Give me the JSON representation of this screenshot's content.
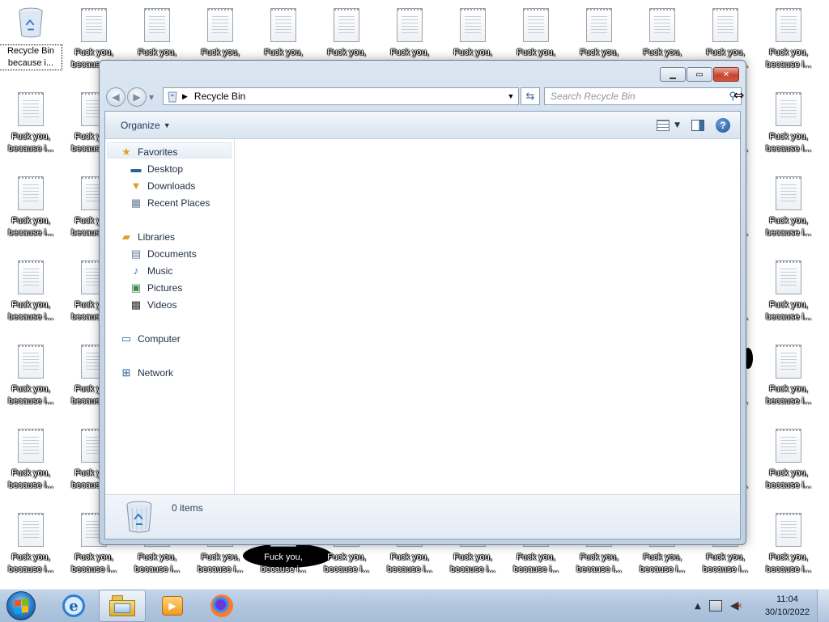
{
  "desktop": {
    "recycle_bin_label": "Recycle Bin",
    "recycle_bin_label2": "because i...",
    "file_label_line1": "Fuck you,",
    "file_label_line2": "because i..."
  },
  "window": {
    "title": "Recycle Bin",
    "address_path": "Recycle Bin",
    "search_placeholder": "Search Recycle Bin",
    "toolbar": {
      "organize_label": "Organize"
    },
    "nav_pane": {
      "favorites": {
        "label": "Favorites",
        "items": [
          {
            "label": "Desktop",
            "icon": "desktop-icon"
          },
          {
            "label": "Downloads",
            "icon": "downloads-icon"
          },
          {
            "label": "Recent Places",
            "icon": "recent-places-icon"
          }
        ]
      },
      "libraries": {
        "label": "Libraries",
        "items": [
          {
            "label": "Documents",
            "icon": "documents-icon"
          },
          {
            "label": "Music",
            "icon": "music-icon"
          },
          {
            "label": "Pictures",
            "icon": "pictures-icon"
          },
          {
            "label": "Videos",
            "icon": "videos-icon"
          }
        ]
      },
      "computer": {
        "label": "Computer"
      },
      "network": {
        "label": "Network"
      }
    },
    "details_pane": {
      "item_count": "0 items"
    }
  },
  "taskbar": {
    "pinned": [
      "start-orb",
      "internet-explorer",
      "windows-explorer",
      "windows-media-player",
      "firefox"
    ],
    "active": "windows-explorer",
    "clock": {
      "time": "11:04",
      "date": "30/10/2022"
    }
  },
  "colors": {
    "taskbar": "#b2c7df",
    "window_frame": "#c8d6e6",
    "close_button": "#c7452f"
  }
}
